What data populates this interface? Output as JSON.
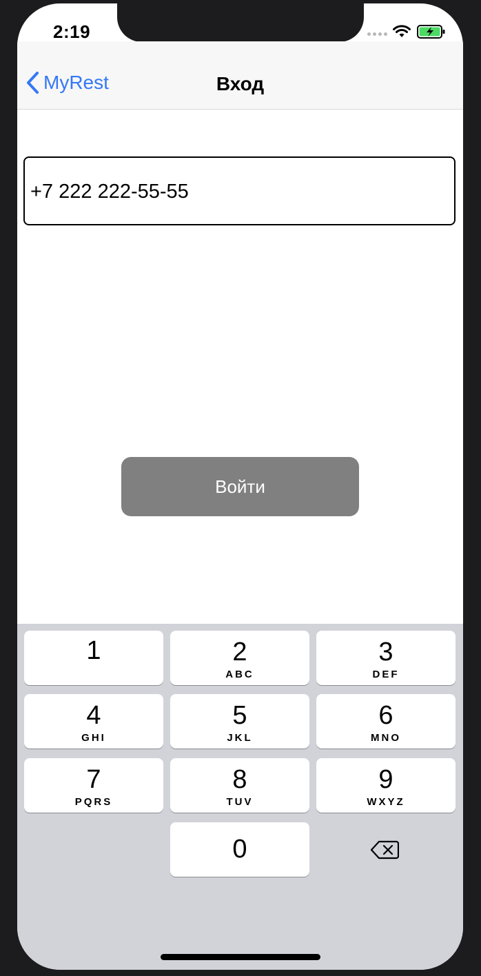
{
  "status_bar": {
    "time": "2:19"
  },
  "navbar": {
    "back_label": "MyRest",
    "title": "Вход"
  },
  "form": {
    "phone_value": "+7 222 222-55-55",
    "login_label": "Войти"
  },
  "keypad": {
    "keys": [
      {
        "digit": "1",
        "letters": ""
      },
      {
        "digit": "2",
        "letters": "ABC"
      },
      {
        "digit": "3",
        "letters": "DEF"
      },
      {
        "digit": "4",
        "letters": "GHI"
      },
      {
        "digit": "5",
        "letters": "JKL"
      },
      {
        "digit": "6",
        "letters": "MNO"
      },
      {
        "digit": "7",
        "letters": "PQRS"
      },
      {
        "digit": "8",
        "letters": "TUV"
      },
      {
        "digit": "9",
        "letters": "WXYZ"
      },
      {
        "digit": "0",
        "letters": ""
      }
    ]
  },
  "colors": {
    "accent": "#3478f6",
    "login_button": "#808080",
    "keyboard_bg": "#d1d3d9",
    "battery_fill": "#4cd964"
  },
  "icons": {
    "back": "chevron-left-icon",
    "wifi": "wifi-icon",
    "battery": "battery-charging-icon",
    "delete": "backspace-icon"
  }
}
